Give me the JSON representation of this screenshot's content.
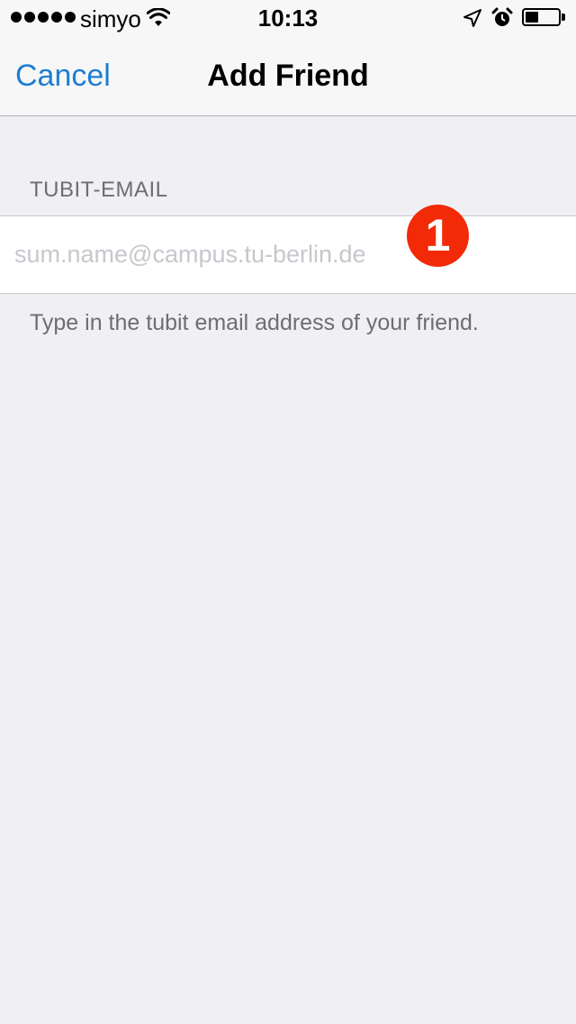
{
  "status_bar": {
    "carrier": "simyo",
    "time": "10:13",
    "signal_bars": 5,
    "battery_level": 0.4,
    "icons": [
      "signal-dots",
      "wifi-icon",
      "location-arrow-icon",
      "alarm-clock-icon",
      "battery-icon"
    ]
  },
  "nav": {
    "cancel_label": "Cancel",
    "title": "Add Friend"
  },
  "form": {
    "section_header": "TUBIT-EMAIL",
    "email_value": "",
    "email_placeholder": "sum.name@campus.tu-berlin.de",
    "footer_text": "Type in the tubit email address of your friend."
  },
  "callout": {
    "number": "1",
    "color": "#f22a08"
  },
  "colors": {
    "accent": "#1e7ed2",
    "background": "#efeff4",
    "secondary_text": "#6d6d72",
    "placeholder": "#c7c7cd"
  }
}
